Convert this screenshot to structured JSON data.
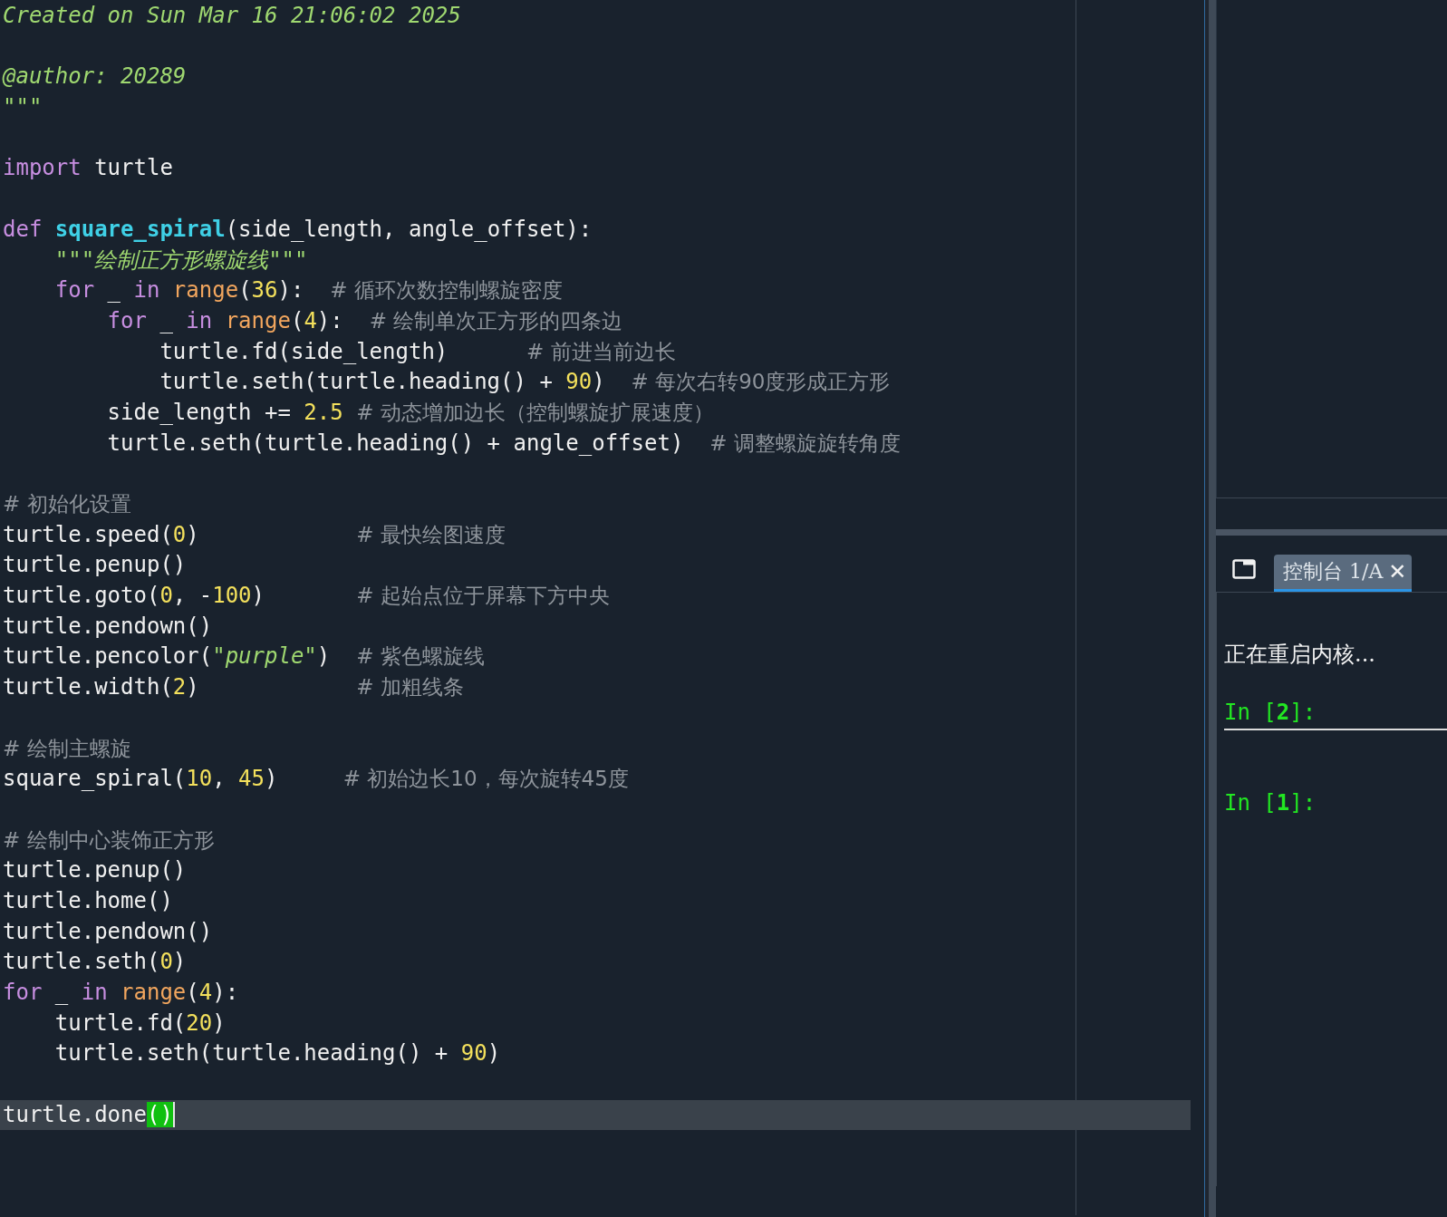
{
  "editor": {
    "lines": [
      {
        "kind": "code",
        "current": false,
        "tokens": [
          {
            "kind": "doc",
            "text": "Created on Sun Mar 16 21:06:02 2025"
          }
        ]
      },
      {
        "kind": "blank"
      },
      {
        "kind": "code",
        "current": false,
        "tokens": [
          {
            "kind": "doc",
            "text": "@author: 20289"
          }
        ]
      },
      {
        "kind": "code",
        "current": false,
        "tokens": [
          {
            "kind": "doc",
            "text": "\"\"\""
          }
        ]
      },
      {
        "kind": "blank"
      },
      {
        "kind": "code",
        "current": false,
        "tokens": [
          {
            "kind": "kw",
            "text": "import"
          },
          {
            "kind": "plain",
            "text": " turtle"
          }
        ]
      },
      {
        "kind": "blank"
      },
      {
        "kind": "code",
        "current": false,
        "tokens": [
          {
            "kind": "kw",
            "text": "def"
          },
          {
            "kind": "fn",
            "text": " square_spiral"
          },
          {
            "kind": "plain",
            "text": "(side_length, angle_offset):"
          }
        ]
      },
      {
        "kind": "code",
        "current": false,
        "tokens": [
          {
            "kind": "doc",
            "text": "    \"\"\"绘制正方形螺旋线\"\"\""
          }
        ]
      },
      {
        "kind": "code",
        "current": false,
        "tokens": [
          {
            "kind": "kw",
            "text": "    for"
          },
          {
            "kind": "plain",
            "text": " _ "
          },
          {
            "kind": "kw",
            "text": "in"
          },
          {
            "kind": "builtin",
            "text": " range"
          },
          {
            "kind": "plain",
            "text": "("
          },
          {
            "kind": "num",
            "text": "36"
          },
          {
            "kind": "plain",
            "text": "):  "
          },
          {
            "kind": "comment",
            "text": "# 循环次数控制螺旋密度"
          }
        ]
      },
      {
        "kind": "code",
        "current": false,
        "tokens": [
          {
            "kind": "kw",
            "text": "        for"
          },
          {
            "kind": "plain",
            "text": " _ "
          },
          {
            "kind": "kw",
            "text": "in"
          },
          {
            "kind": "builtin",
            "text": " range"
          },
          {
            "kind": "plain",
            "text": "("
          },
          {
            "kind": "num",
            "text": "4"
          },
          {
            "kind": "plain",
            "text": "):  "
          },
          {
            "kind": "comment",
            "text": "# 绘制单次正方形的四条边"
          }
        ]
      },
      {
        "kind": "code",
        "current": false,
        "tokens": [
          {
            "kind": "plain",
            "text": "            turtle.fd(side_length)      "
          },
          {
            "kind": "comment",
            "text": "# 前进当前边长"
          }
        ]
      },
      {
        "kind": "code",
        "current": false,
        "tokens": [
          {
            "kind": "plain",
            "text": "            turtle.seth(turtle.heading() + "
          },
          {
            "kind": "num",
            "text": "90"
          },
          {
            "kind": "plain",
            "text": ")  "
          },
          {
            "kind": "comment",
            "text": "# 每次右转90度形成正方形"
          }
        ]
      },
      {
        "kind": "code",
        "current": false,
        "tokens": [
          {
            "kind": "plain",
            "text": "        side_length += "
          },
          {
            "kind": "num",
            "text": "2.5"
          },
          {
            "kind": "comment",
            "text": "  # 动态增加边长（控制螺旋扩展速度）"
          }
        ]
      },
      {
        "kind": "code",
        "current": false,
        "tokens": [
          {
            "kind": "plain",
            "text": "        turtle.seth(turtle.heading() + angle_offset)  "
          },
          {
            "kind": "comment",
            "text": "# 调整螺旋旋转角度"
          }
        ]
      },
      {
        "kind": "blank"
      },
      {
        "kind": "code",
        "current": false,
        "tokens": [
          {
            "kind": "comment",
            "text": "# 初始化设置"
          }
        ]
      },
      {
        "kind": "code",
        "current": false,
        "tokens": [
          {
            "kind": "plain",
            "text": "turtle.speed("
          },
          {
            "kind": "num",
            "text": "0"
          },
          {
            "kind": "plain",
            "text": ")            "
          },
          {
            "kind": "comment",
            "text": "# 最快绘图速度"
          }
        ]
      },
      {
        "kind": "code",
        "current": false,
        "tokens": [
          {
            "kind": "plain",
            "text": "turtle.penup()"
          }
        ]
      },
      {
        "kind": "code",
        "current": false,
        "tokens": [
          {
            "kind": "plain",
            "text": "turtle.goto("
          },
          {
            "kind": "num",
            "text": "0"
          },
          {
            "kind": "plain",
            "text": ", -"
          },
          {
            "kind": "num",
            "text": "100"
          },
          {
            "kind": "plain",
            "text": ")       "
          },
          {
            "kind": "comment",
            "text": "# 起始点位于屏幕下方中央"
          }
        ]
      },
      {
        "kind": "code",
        "current": false,
        "tokens": [
          {
            "kind": "plain",
            "text": "turtle.pendown()"
          }
        ]
      },
      {
        "kind": "code",
        "current": false,
        "tokens": [
          {
            "kind": "plain",
            "text": "turtle.pencolor("
          },
          {
            "kind": "str",
            "text": "\"purple\""
          },
          {
            "kind": "plain",
            "text": ")  "
          },
          {
            "kind": "comment",
            "text": "# 紫色螺旋线"
          }
        ]
      },
      {
        "kind": "code",
        "current": false,
        "tokens": [
          {
            "kind": "plain",
            "text": "turtle.width("
          },
          {
            "kind": "num",
            "text": "2"
          },
          {
            "kind": "plain",
            "text": ")            "
          },
          {
            "kind": "comment",
            "text": "# 加粗线条"
          }
        ]
      },
      {
        "kind": "blank"
      },
      {
        "kind": "code",
        "current": false,
        "tokens": [
          {
            "kind": "comment",
            "text": "# 绘制主螺旋"
          }
        ]
      },
      {
        "kind": "code",
        "current": false,
        "tokens": [
          {
            "kind": "plain",
            "text": "square_spiral("
          },
          {
            "kind": "num",
            "text": "10"
          },
          {
            "kind": "plain",
            "text": ", "
          },
          {
            "kind": "num",
            "text": "45"
          },
          {
            "kind": "plain",
            "text": ")     "
          },
          {
            "kind": "comment",
            "text": "# 初始边长10，每次旋转45度"
          }
        ]
      },
      {
        "kind": "blank"
      },
      {
        "kind": "code",
        "current": false,
        "tokens": [
          {
            "kind": "comment",
            "text": "# 绘制中心装饰正方形"
          }
        ]
      },
      {
        "kind": "code",
        "current": false,
        "tokens": [
          {
            "kind": "plain",
            "text": "turtle.penup()"
          }
        ]
      },
      {
        "kind": "code",
        "current": false,
        "tokens": [
          {
            "kind": "plain",
            "text": "turtle.home()"
          }
        ]
      },
      {
        "kind": "code",
        "current": false,
        "tokens": [
          {
            "kind": "plain",
            "text": "turtle.pendown()"
          }
        ]
      },
      {
        "kind": "code",
        "current": false,
        "tokens": [
          {
            "kind": "plain",
            "text": "turtle.seth("
          },
          {
            "kind": "num",
            "text": "0"
          },
          {
            "kind": "plain",
            "text": ")"
          }
        ]
      },
      {
        "kind": "code",
        "current": false,
        "tokens": [
          {
            "kind": "kw",
            "text": "for"
          },
          {
            "kind": "plain",
            "text": " _ "
          },
          {
            "kind": "kw",
            "text": "in"
          },
          {
            "kind": "builtin",
            "text": " range"
          },
          {
            "kind": "plain",
            "text": "("
          },
          {
            "kind": "num",
            "text": "4"
          },
          {
            "kind": "plain",
            "text": "):"
          }
        ]
      },
      {
        "kind": "code",
        "current": false,
        "tokens": [
          {
            "kind": "plain",
            "text": "    turtle.fd("
          },
          {
            "kind": "num",
            "text": "20"
          },
          {
            "kind": "plain",
            "text": ")"
          }
        ]
      },
      {
        "kind": "code",
        "current": false,
        "tokens": [
          {
            "kind": "plain",
            "text": "    turtle.seth(turtle.heading() + "
          },
          {
            "kind": "num",
            "text": "90"
          },
          {
            "kind": "plain",
            "text": ")"
          }
        ]
      },
      {
        "kind": "blank"
      },
      {
        "kind": "code",
        "current": true,
        "tokens": [
          {
            "kind": "plain",
            "text": "turtle.done"
          },
          {
            "kind": "match",
            "text": "()"
          }
        ]
      }
    ]
  },
  "console": {
    "tab": {
      "label": "控制台 1/A",
      "selected": true,
      "close": "✕"
    },
    "lines": [
      {
        "kind": "message",
        "text": "正在重启内核..."
      },
      {
        "kind": "prompt",
        "text": "In [**2**]:",
        "separator": true
      },
      {
        "kind": "prompt",
        "text": "In [**1**]:",
        "separator": false
      }
    ]
  }
}
